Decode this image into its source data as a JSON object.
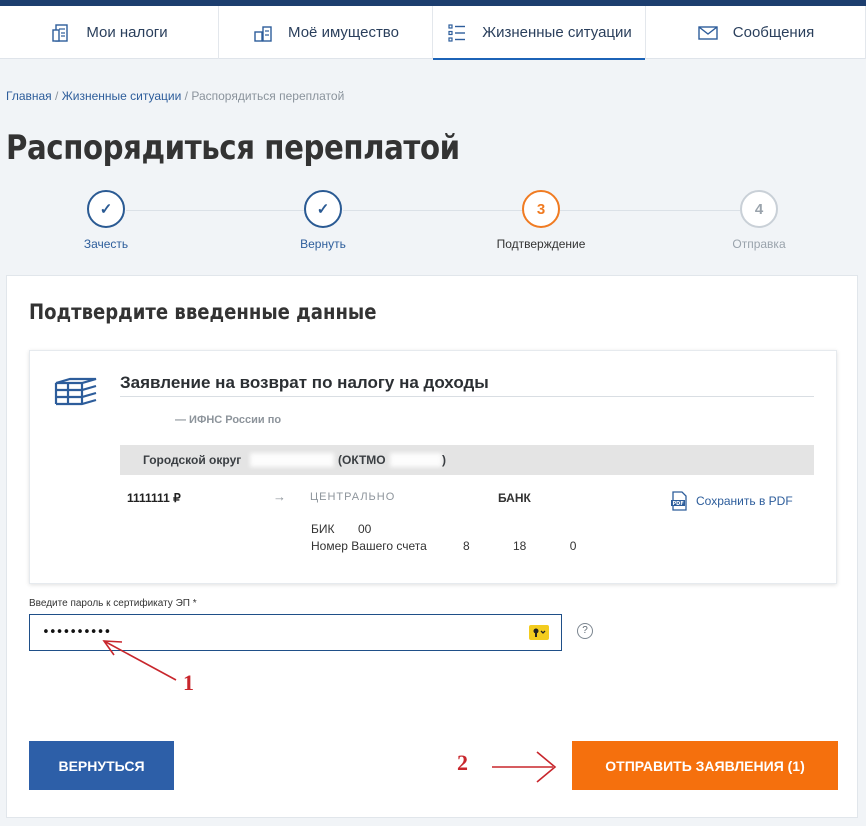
{
  "nav": {
    "items": [
      {
        "label": "Мои налоги",
        "icon": "tax-calc-icon"
      },
      {
        "label": "Моё имущество",
        "icon": "property-icon"
      },
      {
        "label": "Жизненные ситуации",
        "icon": "list-icon"
      },
      {
        "label": "Сообщения",
        "icon": "envelope-icon"
      }
    ]
  },
  "breadcrumb": {
    "home": "Главная",
    "sep1": " / ",
    "section": "Жизненные ситуации",
    "sep2": " / ",
    "current": "Распорядиться переплатой"
  },
  "page_title": "Распорядиться переплатой",
  "steps": [
    {
      "label": "Зачесть",
      "marker": "✓",
      "state": "done"
    },
    {
      "label": "Вернуть",
      "marker": "✓",
      "state": "done"
    },
    {
      "label": "Подтверждение",
      "marker": "3",
      "state": "current"
    },
    {
      "label": "Отправка",
      "marker": "4",
      "state": "pending"
    }
  ],
  "form": {
    "title": "Подтвердите введенные данные",
    "document": {
      "title": "Заявление на возврат по налогу на доходы",
      "ifns": "— ИФНС России по",
      "okrug_label": "Городской округ",
      "oktmo_label": "(ОКТМО",
      "oktmo_close": ")",
      "amount": "1111111  ₽",
      "bank_name": "ЦЕНТРАЛЬНО",
      "bank": "БАНК",
      "bik_label": "БИК",
      "bik_value": "00",
      "account_label": "Номер Вашего счета",
      "account_value": "8 18 0",
      "pdf_label": "Сохранить в PDF"
    },
    "password": {
      "label": "Введите пароль к сертификату ЭП *",
      "value": "••••••••••",
      "help": "?"
    },
    "back_label": "ВЕРНУТЬСЯ",
    "send_label": "ОТПРАВИТЬ ЗАЯВЛЕНИЯ (1)"
  },
  "annotations": {
    "one": "1",
    "two": "2",
    "color": "#c8262c"
  },
  "colors": {
    "primary": "#2d5fa8",
    "accent": "#f5700d",
    "navy": "#1d3e6e"
  }
}
